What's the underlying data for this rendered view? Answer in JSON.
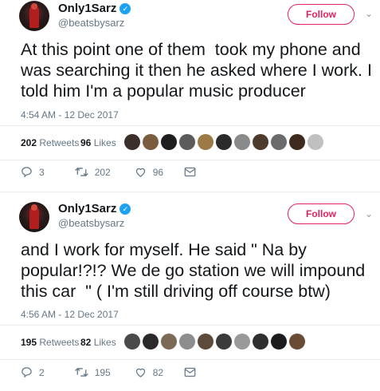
{
  "tweets": [
    {
      "user": {
        "display_name": "Only1Sarz",
        "handle": "@beatsbysarz",
        "verified_glyph": "✓"
      },
      "follow_label": "Follow",
      "menu_glyph": "⌄",
      "text": "At this point one of them  took my phone and was searching it then he asked where I work. I told him I'm a popular music producer",
      "timestamp": "4:54 AM - 12 Dec 2017",
      "retweets_count": "202",
      "retweets_label": "Retweets",
      "likes_count": "96",
      "likes_label": "Likes",
      "likers": [
        "#3a2f2a",
        "#7a5c3e",
        "#1e1e1e",
        "#5b5b5b",
        "#9c7a45",
        "#2b2b2b",
        "#8a8a8a",
        "#4d3b2e",
        "#6b6b6b",
        "#3f2a1e",
        "#c0c0c0"
      ],
      "actions": {
        "reply": "3",
        "retweet": "202",
        "like": "96"
      }
    },
    {
      "user": {
        "display_name": "Only1Sarz",
        "handle": "@beatsbysarz",
        "verified_glyph": "✓"
      },
      "follow_label": "Follow",
      "menu_glyph": "⌄",
      "text": "and I work for myself. He said \" Na by popular!?!? We de go station we will impound this car  \" ( I'm still driving off course btw)",
      "timestamp": "4:56 AM - 12 Dec 2017",
      "retweets_count": "195",
      "retweets_label": "Retweets",
      "likes_count": "82",
      "likes_label": "Likes",
      "likers": [
        "#4a4a4a",
        "#2a2a2a",
        "#7b6a55",
        "#8d8d8d",
        "#5e4a3a",
        "#3b3b3b",
        "#9a9a9a",
        "#2f2f2f",
        "#1c1c1c",
        "#6a4b35"
      ],
      "actions": {
        "reply": "2",
        "retweet": "195",
        "like": "82"
      }
    }
  ]
}
